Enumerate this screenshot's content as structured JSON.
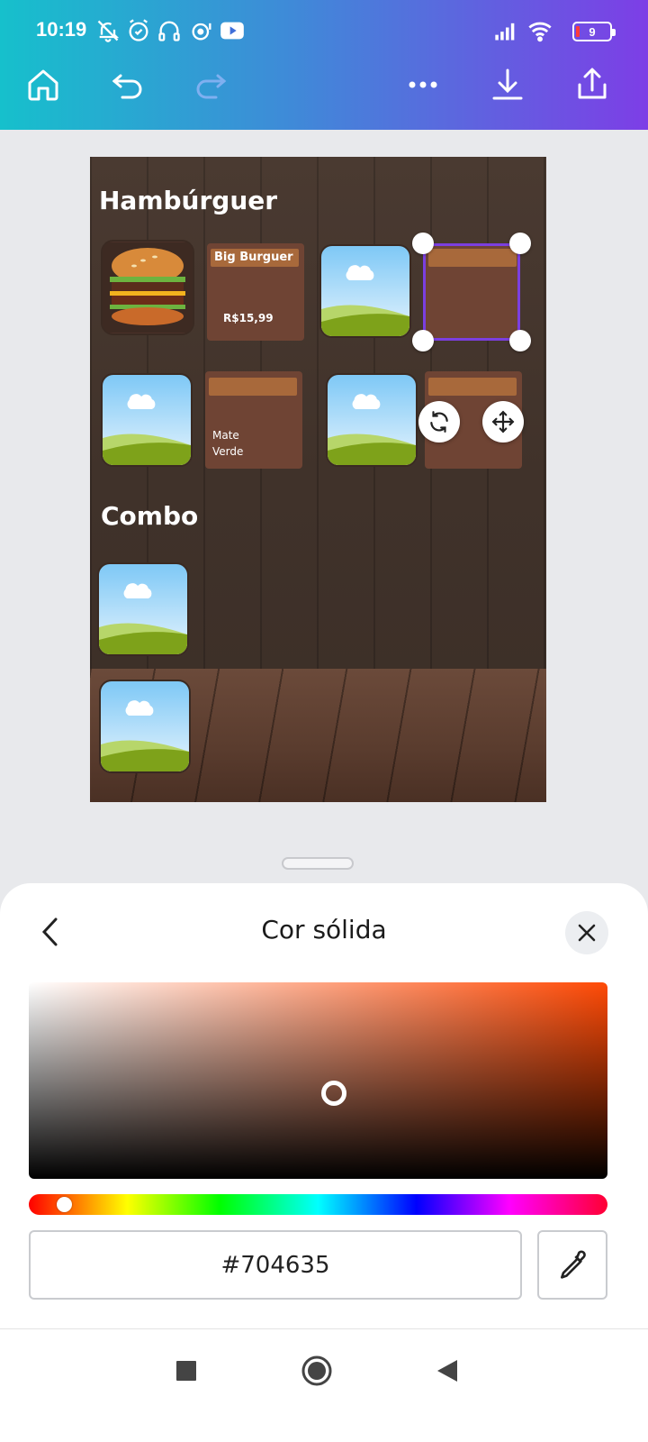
{
  "status_bar": {
    "time": "10:19",
    "battery": "9",
    "icons": [
      "bell-off-icon",
      "alarm-icon",
      "headset-icon",
      "cloud-sync-icon",
      "youtube-icon",
      "signal-icon",
      "wifi-icon",
      "battery-icon"
    ]
  },
  "toolbar": {
    "items": [
      "home-icon",
      "undo-icon",
      "redo-icon",
      "more-icon",
      "download-icon",
      "share-icon"
    ]
  },
  "design": {
    "section1_title": "Hambúrguer",
    "section2_title": "Combo",
    "card1": {
      "title": "Big Burguer",
      "price": "R$15,99"
    },
    "card2": {
      "desc": "Mate\nVerde"
    }
  },
  "color_panel": {
    "title": "Cor sólida",
    "hex_value": "#704635",
    "hue_color": "#ff4a06"
  },
  "nav": {
    "items": [
      "recents-button",
      "home-button",
      "back-button"
    ]
  },
  "colors": {
    "gradient_start": "#16c0cc",
    "gradient_end": "#7d3ee6",
    "selection": "#7b3fe0",
    "card": "#6f4434"
  }
}
